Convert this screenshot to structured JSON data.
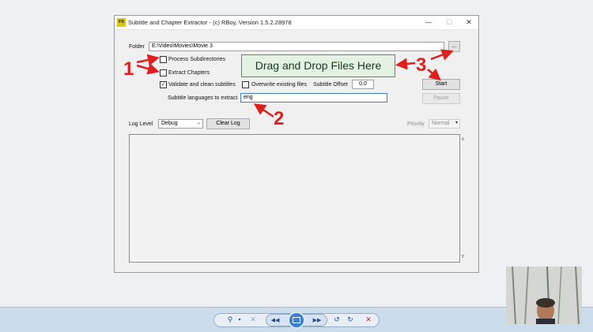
{
  "window": {
    "title": "Subtitle and Chapter Extractor - (c) RBoy, Version 1.5.2.28978",
    "app_icon_text": "FR",
    "minimize": "—",
    "maximize": "☐",
    "close": "✕"
  },
  "form": {
    "folder_label": "Folder",
    "folder_value": "E:\\Video\\Movies\\Movie 3",
    "browse_label": "...",
    "process_subdirs_label": "Process Subdirectories",
    "process_subdirs_checked": false,
    "extract_chapters_label": "Extract Chapters",
    "extract_chapters_checked": false,
    "validate_label": "Validate and clean subtitles",
    "validate_checked": true,
    "overwrite_label": "Overwrite existing files",
    "overwrite_checked": false,
    "offset_label": "Subtitle Offset",
    "offset_value": "0.0",
    "languages_label": "Subtitle languages to extract",
    "languages_value": "eng",
    "drop_zone_text": "Drag and Drop Files Here",
    "start_label": "Start",
    "pause_label": "Pause"
  },
  "log": {
    "level_label": "Log Level",
    "level_value": "Debug",
    "clear_label": "Clear Log",
    "priority_label": "Priority",
    "priority_value": "Normal"
  },
  "annotations": {
    "one": "1",
    "two": "2",
    "three": "3",
    "color": "#e01e1e"
  },
  "icons": {
    "checkmark": "checkmark-icon",
    "dropdown": "chevron-down-icon"
  },
  "viewer_toolbar": {
    "zoom": "zoom-icon",
    "fit": "fit-to-window-icon",
    "previous": "previous-icon",
    "slideshow": "slideshow-icon",
    "next": "next-icon",
    "rotate_ccw": "rotate-counterclockwise-icon",
    "rotate_cw": "rotate-clockwise-icon",
    "delete": "delete-icon",
    "colors": {
      "bar": "#cbdcec",
      "accent": "#3d7fcf",
      "delete": "#cc2222"
    }
  }
}
